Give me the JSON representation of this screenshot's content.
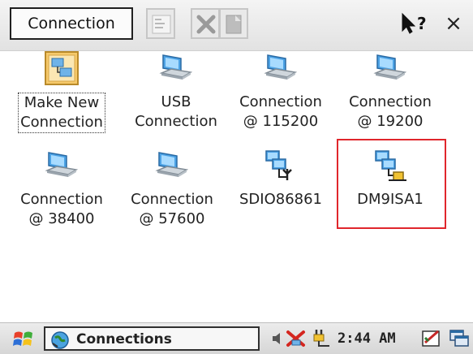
{
  "toolbar": {
    "menu_label": "Connection",
    "help_label": "?",
    "close_label": "×"
  },
  "items": [
    {
      "label": "Make New\nConnection",
      "icon": "make-new-connection-icon",
      "selected": true
    },
    {
      "label": "USB\nConnection",
      "icon": "network-computer-icon"
    },
    {
      "label": "Connection\n@ 115200",
      "icon": "network-computer-icon"
    },
    {
      "label": "Connection\n@ 19200",
      "icon": "network-computer-icon"
    },
    {
      "label": "Connection\n@ 38400",
      "icon": "network-computer-icon"
    },
    {
      "label": "Connection\n@ 57600",
      "icon": "network-computer-icon"
    },
    {
      "label": "SDIO86861",
      "icon": "wireless-adapter-icon"
    },
    {
      "label": "DM9ISA1",
      "icon": "wired-adapter-icon",
      "highlighted": true
    }
  ],
  "highlight_color": "#e0262c",
  "taskbar": {
    "task_label": "Connections",
    "clock": "2:44 AM"
  }
}
